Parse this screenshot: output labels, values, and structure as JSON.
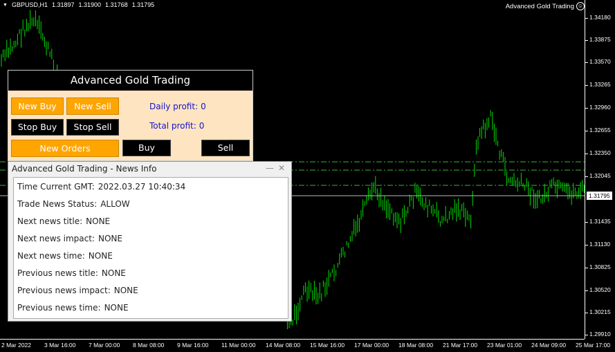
{
  "header": {
    "symbol": "GBPUSD,H1",
    "quotes": [
      "1.31897",
      "1.31900",
      "1.31768",
      "1.31795"
    ]
  },
  "ea_label": "Advanced Gold Trading",
  "price_axis": {
    "ticks": [
      "1.34180",
      "1.33875",
      "1.33570",
      "1.33265",
      "1.32960",
      "1.32655",
      "1.32350",
      "1.32045",
      "1.31435",
      "1.31130",
      "1.30825",
      "1.30520",
      "1.30215",
      "1.29910"
    ],
    "current": "1.31795"
  },
  "time_axis": {
    "ticks": [
      "2 Mar 2022",
      "3 Mar 16:00",
      "7 Mar 00:00",
      "8 Mar 08:00",
      "9 Mar 16:00",
      "11 Mar 00:00",
      "14 Mar 08:00",
      "15 Mar 16:00",
      "17 Mar 00:00",
      "18 Mar 08:00",
      "21 Mar 17:00",
      "23 Mar 01:00",
      "24 Mar 09:00",
      "25 Mar 17:00"
    ]
  },
  "panel": {
    "title": "Advanced Gold Trading",
    "new_buy": "New Buy",
    "new_sell": "New Sell",
    "stop_buy": "Stop Buy",
    "stop_sell": "Stop Sell",
    "new_orders": "New Orders",
    "buy": "Buy",
    "sell": "Sell",
    "daily_profit_label": "Daily profit:",
    "daily_profit_value": "0",
    "total_profit_label": "Total profit:",
    "total_profit_value": "0"
  },
  "news": {
    "title": "Advanced Gold Trading - News Info",
    "rows": [
      {
        "label": "Time Current GMT:",
        "value": "2022.03.27 10:40:34"
      },
      {
        "label": "Trade News Status:",
        "value": "ALLOW"
      },
      {
        "label": "Next news title:",
        "value": "NONE"
      },
      {
        "label": "Next news impact:",
        "value": "NONE"
      },
      {
        "label": "Next news time:",
        "value": "NONE"
      },
      {
        "label": "Previous news title:",
        "value": "NONE"
      },
      {
        "label": "Previous news impact:",
        "value": "NONE"
      },
      {
        "label": "Previous news time:",
        "value": "NONE"
      }
    ]
  },
  "colors": {
    "background": "#000000",
    "candle": "#00e000",
    "level_line": "#3cb43c",
    "panel_bg": "#ffe4c2",
    "button_orange": "#ffa500",
    "profit_text": "#1414c8"
  }
}
